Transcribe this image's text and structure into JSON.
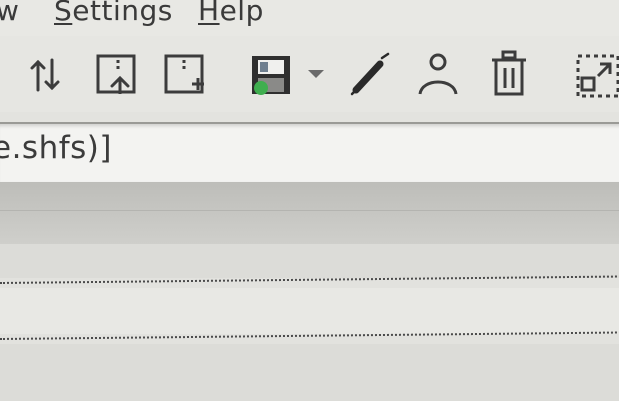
{
  "menubar": {
    "items": [
      {
        "label": "w",
        "mnemonic": ""
      },
      {
        "label": "ettings",
        "mnemonic": "S"
      },
      {
        "label": "elp",
        "mnemonic": "H"
      }
    ]
  },
  "toolbar": {
    "buttons": [
      {
        "icon": "move-arrows-icon"
      },
      {
        "icon": "upload-page-icon"
      },
      {
        "icon": "new-page-icon"
      },
      {
        "icon": "save-disk-icon"
      },
      {
        "icon": "dropdown-arrow-icon"
      },
      {
        "icon": "pen-icon"
      },
      {
        "icon": "user-icon"
      },
      {
        "icon": "trash-icon"
      },
      {
        "icon": "expand-icon"
      }
    ],
    "colors": {
      "icon": "#3c3c3c",
      "accent_green": "#3fae4f"
    }
  },
  "location": {
    "value": "e.shfs)]"
  },
  "colors": {
    "background": "#e4e4e0",
    "header": "#c4c4c0",
    "field": "#f3f3f1"
  }
}
